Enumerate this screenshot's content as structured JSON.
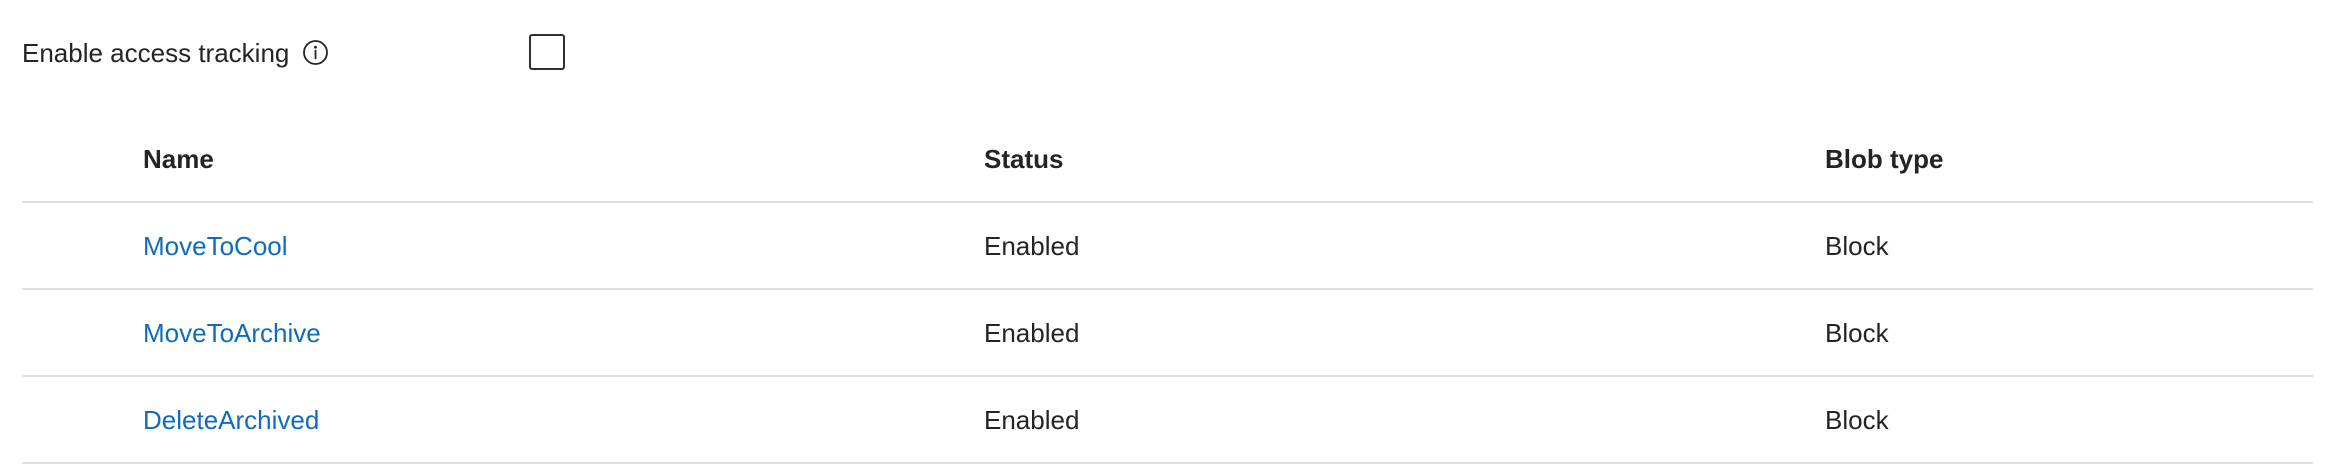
{
  "access_tracking": {
    "label": "Enable access tracking",
    "info_icon": "info-icon",
    "checked": false
  },
  "table": {
    "headers": {
      "name": "Name",
      "status": "Status",
      "blob_type": "Blob type"
    },
    "rows": [
      {
        "name": "MoveToCool",
        "status": "Enabled",
        "blob_type": "Block"
      },
      {
        "name": "MoveToArchive",
        "status": "Enabled",
        "blob_type": "Block"
      },
      {
        "name": "DeleteArchived",
        "status": "Enabled",
        "blob_type": "Block"
      }
    ]
  },
  "colors": {
    "link": "#0f6cbd",
    "text": "#242424",
    "divider": "#e1dfdd"
  }
}
